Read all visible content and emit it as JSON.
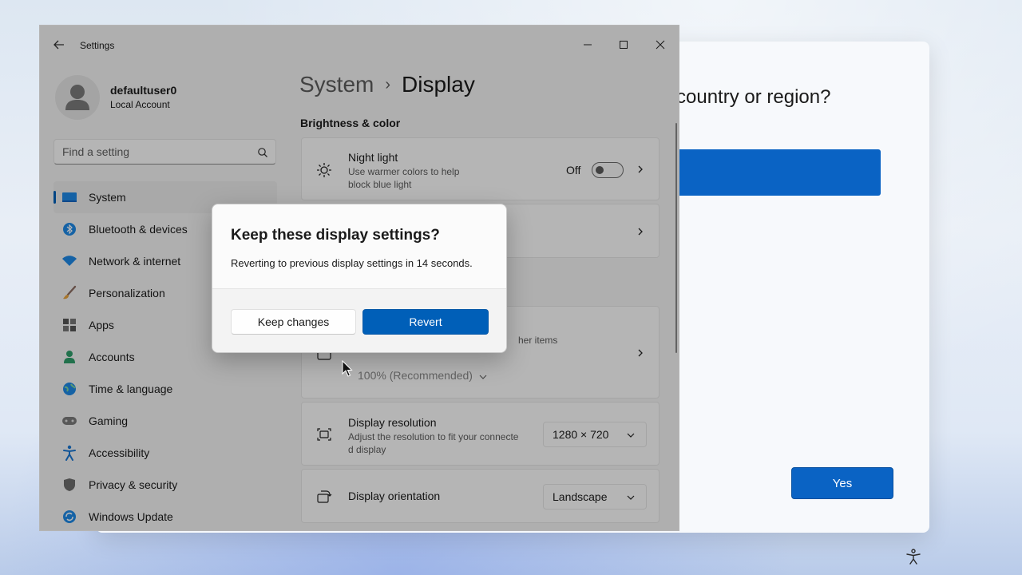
{
  "oobe": {
    "question": "country or region?",
    "yes_label": "Yes"
  },
  "settings": {
    "app_title": "Settings",
    "user": {
      "name": "defaultuser0",
      "account_type": "Local Account"
    },
    "search_placeholder": "Find a setting",
    "nav": [
      {
        "label": "System",
        "icon": "system-monitor-icon",
        "active": true
      },
      {
        "label": "Bluetooth & devices",
        "icon": "bluetooth-icon"
      },
      {
        "label": "Network & internet",
        "icon": "wifi-icon"
      },
      {
        "label": "Personalization",
        "icon": "brush-icon"
      },
      {
        "label": "Apps",
        "icon": "apps-icon"
      },
      {
        "label": "Accounts",
        "icon": "accounts-icon"
      },
      {
        "label": "Time & language",
        "icon": "globe-clock-icon"
      },
      {
        "label": "Gaming",
        "icon": "gamepad-icon"
      },
      {
        "label": "Accessibility",
        "icon": "accessibility-icon"
      },
      {
        "label": "Privacy & security",
        "icon": "shield-icon"
      },
      {
        "label": "Windows Update",
        "icon": "update-icon"
      }
    ],
    "breadcrumb": {
      "parent": "System",
      "separator": "›",
      "current": "Display"
    },
    "section_brightness": "Brightness & color",
    "night_light": {
      "title": "Night light",
      "desc_line1": "Use warmer colors to help",
      "desc_line2": "block blue light",
      "state_label": "Off",
      "on": false
    },
    "scale": {
      "desc_fragment": "her items",
      "value": "100% (Recommended)"
    },
    "resolution": {
      "title": "Display resolution",
      "desc_line1": "Adjust the resolution to fit your connecte",
      "desc_line2": "d display",
      "value": "1280 × 720"
    },
    "orientation": {
      "title": "Display orientation",
      "value": "Landscape"
    }
  },
  "dialog": {
    "title": "Keep these display settings?",
    "message": "Reverting to previous display settings in 14 seconds.",
    "countdown_seconds": 14,
    "keep_label": "Keep changes",
    "revert_label": "Revert"
  },
  "colors": {
    "accent": "#005fb8",
    "oobe_accent": "#0a63c4"
  }
}
